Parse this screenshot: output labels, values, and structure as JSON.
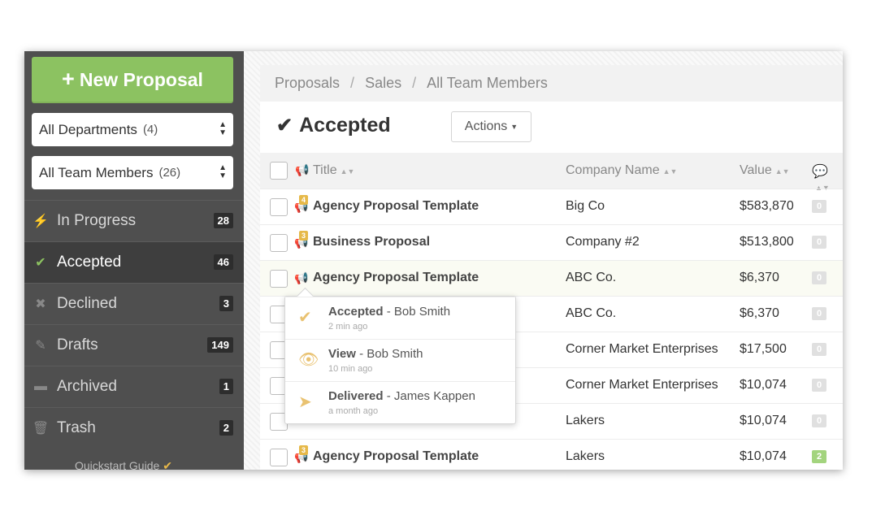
{
  "sidebar": {
    "new_proposal_label": "New Proposal",
    "dept_select": {
      "label": "All Departments",
      "count": "(4)"
    },
    "member_select": {
      "label": "All Team Members",
      "count": "(26)"
    },
    "items": [
      {
        "label": "In Progress",
        "count": "28",
        "icon": "bolt-icon"
      },
      {
        "label": "Accepted",
        "count": "46",
        "icon": "check-icon"
      },
      {
        "label": "Declined",
        "count": "3",
        "icon": "x-icon"
      },
      {
        "label": "Drafts",
        "count": "149",
        "icon": "pencil-icon"
      },
      {
        "label": "Archived",
        "count": "1",
        "icon": "archive-icon"
      },
      {
        "label": "Trash",
        "count": "2",
        "icon": "trash-icon"
      }
    ],
    "quickstart_label": "Quickstart Guide"
  },
  "breadcrumb": [
    "Proposals",
    "Sales",
    "All Team Members"
  ],
  "page_title": "Accepted",
  "actions_label": "Actions",
  "table": {
    "headers": {
      "title": "Title",
      "company": "Company Name",
      "value": "Value"
    },
    "rows": [
      {
        "badge": "4",
        "title": "Agency Proposal Template",
        "company": "Big Co",
        "value": "$583,870",
        "comments": "0"
      },
      {
        "badge": "3",
        "title": "Business Proposal",
        "company": "Company #2",
        "value": "$513,800",
        "comments": "0"
      },
      {
        "badge": "",
        "title": "Agency Proposal Template",
        "company": "ABC Co.",
        "value": "$6,370",
        "comments": "0"
      },
      {
        "badge": "",
        "title": "",
        "company": "ABC Co.",
        "value": "$6,370",
        "comments": "0"
      },
      {
        "badge": "",
        "title": "",
        "company": "Corner Market Enterprises",
        "value": "$17,500",
        "comments": "0"
      },
      {
        "badge": "",
        "title": "",
        "company": "Corner Market Enterprises",
        "value": "$10,074",
        "comments": "0"
      },
      {
        "badge": "",
        "title": "",
        "company": "Lakers",
        "value": "$10,074",
        "comments": "0"
      },
      {
        "badge": "3",
        "title": "Agency Proposal Template",
        "company": "Lakers",
        "value": "$10,074",
        "comments": "2"
      }
    ]
  },
  "popover": [
    {
      "status": "Accepted",
      "person": "- Bob Smith",
      "time": "2 min ago",
      "icon": "check-icon"
    },
    {
      "status": "View",
      "person": "- Bob Smith",
      "time": "10 min ago",
      "icon": "eye-icon"
    },
    {
      "status": "Delivered",
      "person": "- James Kappen",
      "time": "a month ago",
      "icon": "paper-plane-icon"
    }
  ]
}
